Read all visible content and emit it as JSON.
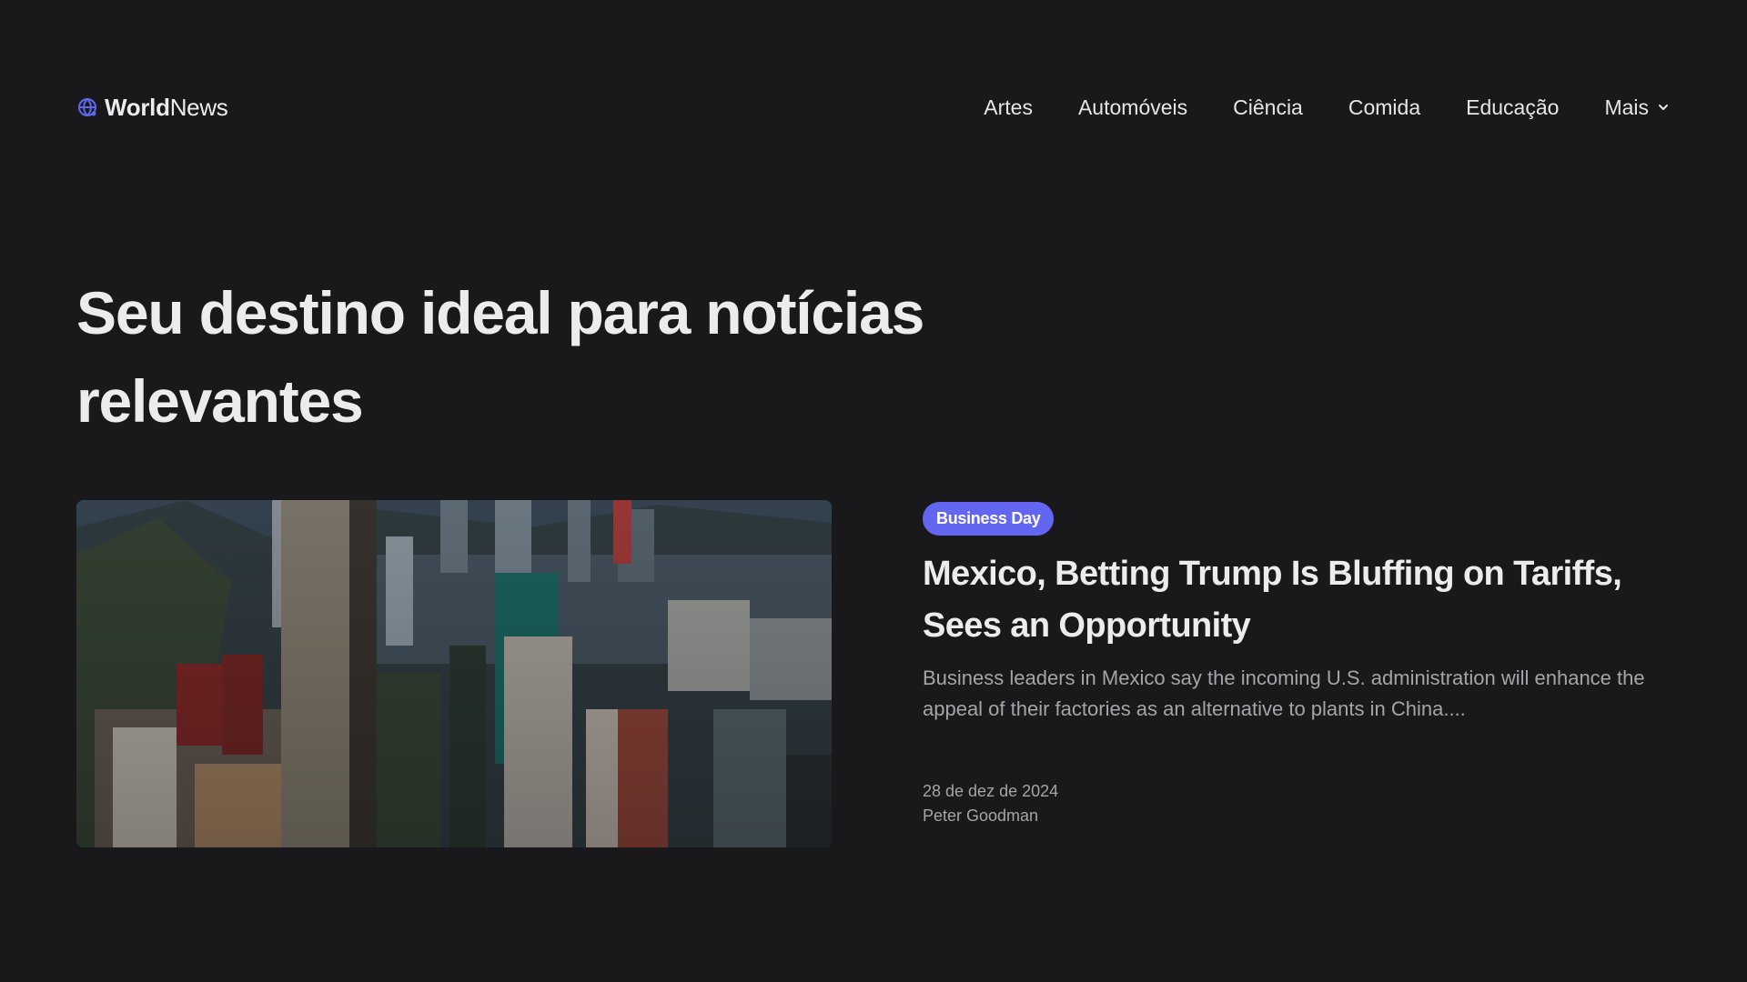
{
  "brand": {
    "bold": "World",
    "light": "News",
    "icon": "globe-icon",
    "icon_color": "#6366f1"
  },
  "nav": {
    "items": [
      "Artes",
      "Automóveis",
      "Ciência",
      "Comida",
      "Educação"
    ],
    "more_label": "Mais"
  },
  "hero": {
    "title": "Seu destino ideal para notícias relevantes"
  },
  "featured": {
    "category": "Business Day",
    "category_color": "#6366f1",
    "title": "Mexico, Betting Trump Is Bluffing on Tariffs, Sees an Opportunity",
    "excerpt": "Business leaders in Mexico say the incoming U.S. administration will enhance the appeal of their factories as an alternative to plants in China....",
    "date": "28 de dez de 2024",
    "author": "Peter Goodman"
  },
  "colors": {
    "background": "#19191b",
    "text": "#ececee",
    "muted": "#a4a4aa",
    "accent": "#6366f1"
  }
}
